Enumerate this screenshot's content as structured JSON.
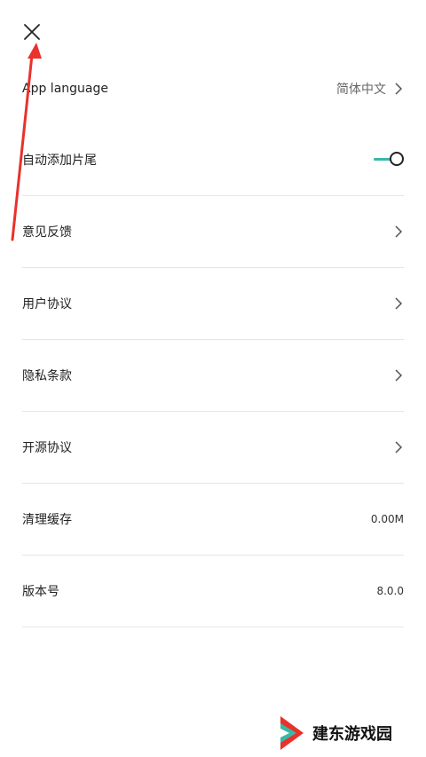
{
  "header": {
    "close_icon": "close-icon"
  },
  "settings": {
    "app_language": {
      "label": "App language",
      "value": "简体中文"
    },
    "auto_outro": {
      "label": "自动添加片尾",
      "enabled": true
    },
    "feedback": {
      "label": "意见反馈"
    },
    "user_agreement": {
      "label": "用户协议"
    },
    "privacy": {
      "label": "隐私条款"
    },
    "open_source": {
      "label": "开源协议"
    },
    "clear_cache": {
      "label": "清理缓存",
      "value": "0.00M"
    },
    "version": {
      "label": "版本号",
      "value": "8.0.0"
    }
  },
  "watermark": {
    "text": "建东游戏园"
  },
  "colors": {
    "accent": "#3bb7a6",
    "annotation": "#e8322b",
    "divider": "#e6e6e6"
  }
}
